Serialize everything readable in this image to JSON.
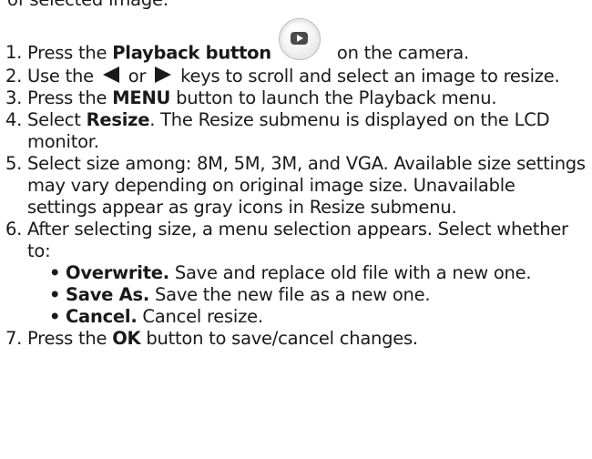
{
  "top_fragment": "of selected image.",
  "steps": [
    {
      "num": "1.",
      "pre": "Press the ",
      "bold": "Playback button",
      "post": " on the camera."
    },
    {
      "num": "2.",
      "pre": "Use the ",
      "mid": " or ",
      "post": " keys to scroll and select an image to resize."
    },
    {
      "num": "3.",
      "pre": "Press the ",
      "bold": "MENU",
      "post": " button to launch the Playback menu."
    },
    {
      "num": "4.",
      "pre": "Select ",
      "bold": "Resize",
      "post": ". The Resize submenu is displayed on the LCD monitor."
    },
    {
      "num": "5.",
      "text": "Select size among: 8M, 5M, 3M, and VGA. Available size settings may vary depending on original image size. Unavailable settings appear as gray icons in Resize submenu."
    },
    {
      "num": "6.",
      "text": "After selecting size, a menu selection appears. Select whether to:",
      "options": [
        {
          "bold": "Overwrite.",
          "text": " Save and replace old file with a new one."
        },
        {
          "bold": "Save As.",
          "text": " Save the new file as a new one."
        },
        {
          "bold": "Cancel.",
          "text": " Cancel resize."
        }
      ]
    },
    {
      "num": "7.",
      "pre": "Press the ",
      "bold": "OK",
      "post": " button to save/cancel changes."
    }
  ],
  "icons": {
    "playback": "playback-button-icon",
    "left": "left-arrow-key-icon",
    "right": "right-arrow-key-icon"
  }
}
